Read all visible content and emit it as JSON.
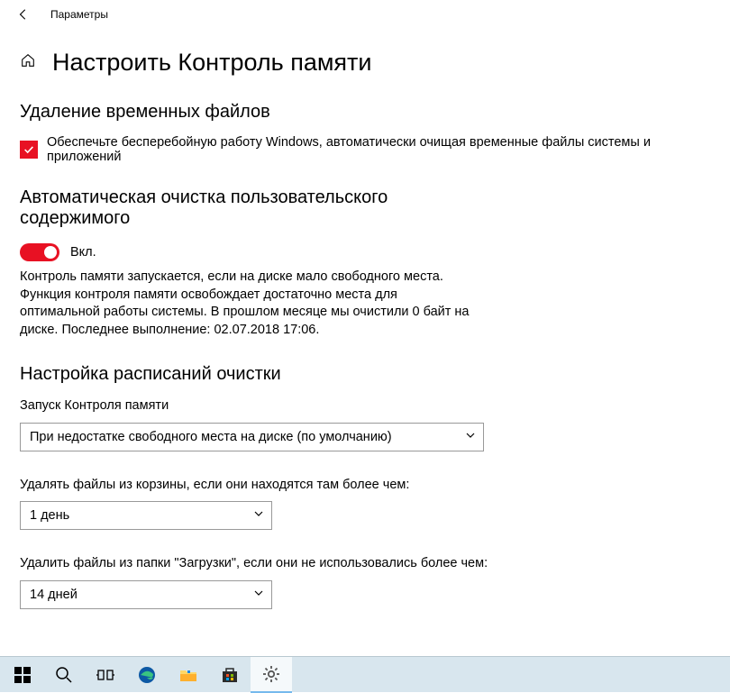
{
  "titlebar": {
    "label": "Параметры"
  },
  "page": {
    "title": "Настроить Контроль памяти"
  },
  "section_temp": {
    "title": "Удаление временных файлов",
    "checkbox_label": "Обеспечьте бесперебойную работу Windows, автоматически очищая временные файлы системы и приложений"
  },
  "section_auto": {
    "title": "Автоматическая очистка пользовательского содержимого",
    "toggle_label": "Вкл.",
    "description": "Контроль памяти запускается, если на диске мало свободного места. Функция контроля памяти освобождает достаточно места для оптимальной работы системы. В прошлом месяце мы очистили 0 байт на диске. Последнее выполнение: 02.07.2018 17:06."
  },
  "section_schedule": {
    "title": "Настройка расписаний очистки",
    "run_label": "Запуск Контроля памяти",
    "run_value": "При недостатке свободного места на диске (по умолчанию)",
    "recycle_label": "Удалять файлы из корзины, если они находятся там более чем:",
    "recycle_value": "1 день",
    "downloads_label": "Удалить файлы из папки \"Загрузки\", если они не использовались более чем:",
    "downloads_value": "14 дней"
  }
}
